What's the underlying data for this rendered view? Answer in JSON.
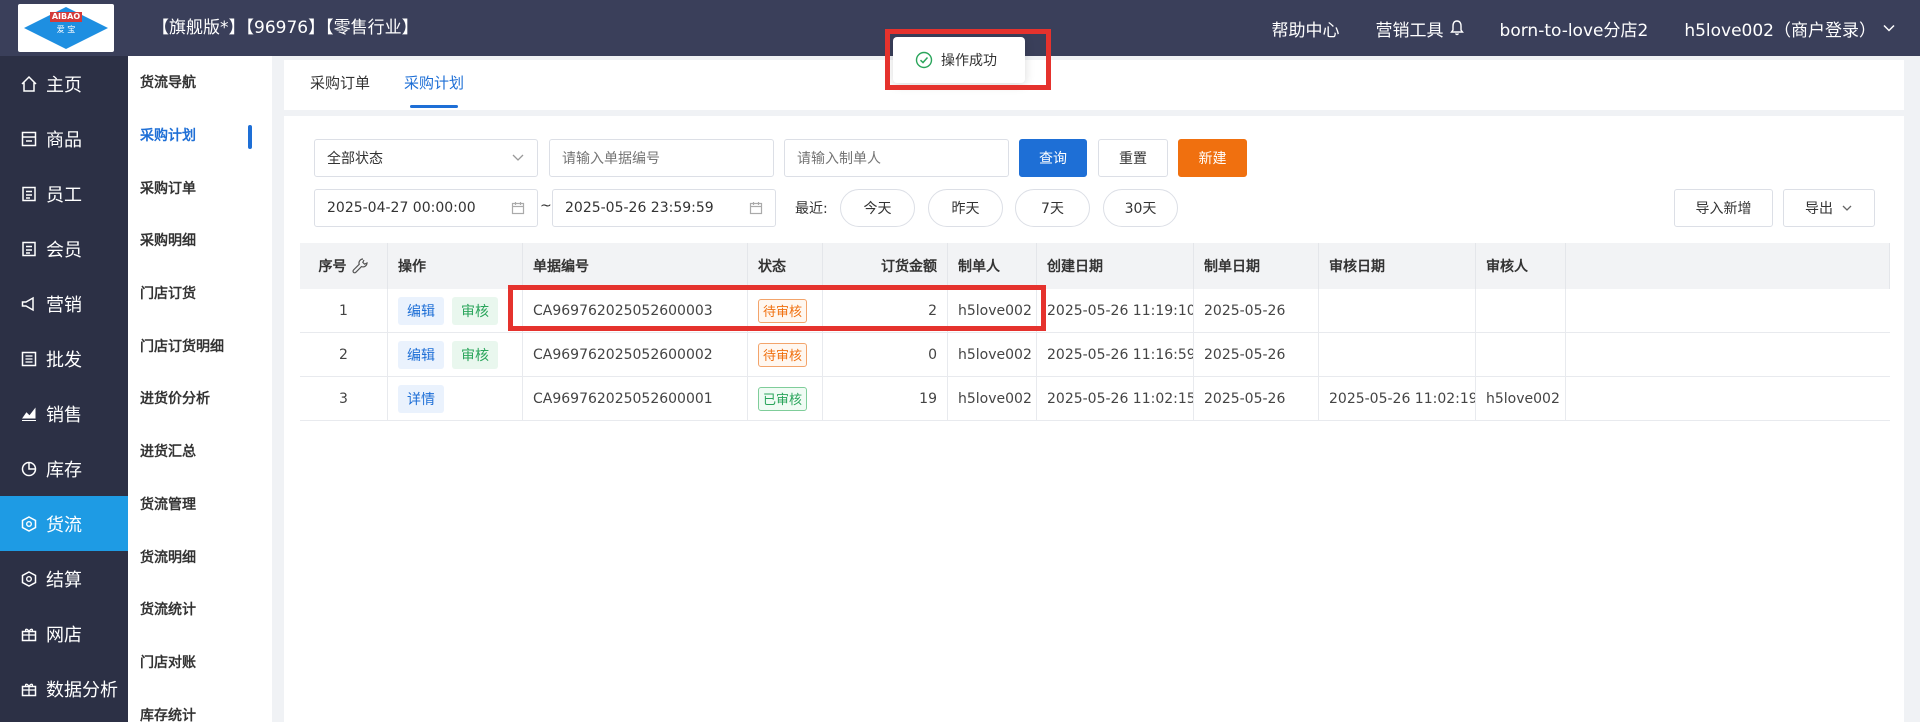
{
  "header": {
    "logo_top": "AIBAO",
    "logo_bottom": "爱 宝",
    "edition": "【旗舰版*】【96976】【零售行业】",
    "help": "帮助中心",
    "marketing": "营销工具",
    "store": "born-to-love分店2",
    "user": "h5love002（商户登录）"
  },
  "sidebar": {
    "items": [
      {
        "label": "主页",
        "icon": "home-icon"
      },
      {
        "label": "商品",
        "icon": "goods-icon"
      },
      {
        "label": "员工",
        "icon": "staff-icon"
      },
      {
        "label": "会员",
        "icon": "member-icon"
      },
      {
        "label": "营销",
        "icon": "megaphone-icon"
      },
      {
        "label": "批发",
        "icon": "wholesale-icon"
      },
      {
        "label": "销售",
        "icon": "sales-chart-icon"
      },
      {
        "label": "库存",
        "icon": "stock-pie-icon"
      },
      {
        "label": "货流",
        "icon": "logistics-icon"
      },
      {
        "label": "结算",
        "icon": "settle-icon"
      },
      {
        "label": "网店",
        "icon": "gift-icon"
      },
      {
        "label": "数据分析",
        "icon": "gift-icon"
      }
    ],
    "active_index": 8
  },
  "subnav": {
    "items": [
      "货流导航",
      "采购计划",
      "采购订单",
      "采购明细",
      "门店订货",
      "门店订货明细",
      "进货价分析",
      "进货汇总",
      "货流管理",
      "货流明细",
      "货流统计",
      "门店对账",
      "库存统计"
    ],
    "active_index": 1
  },
  "tabs": [
    "采购订单",
    "采购计划"
  ],
  "active_tab": 1,
  "filters": {
    "status_select": "全部状态",
    "doc_no_placeholder": "请输入单据编号",
    "maker_placeholder": "请输入制单人",
    "query": "查询",
    "reset": "重置",
    "create": "新建",
    "date_start": "2025-04-27 00:00:00",
    "date_sep": "~",
    "date_end": "2025-05-26 23:59:59",
    "recent_label": "最近:",
    "today": "今天",
    "yesterday": "昨天",
    "days7": "7天",
    "days30": "30天",
    "import": "导入新增",
    "export": "导出"
  },
  "table": {
    "headers": [
      "序号",
      "操作",
      "单据编号",
      "状态",
      "订货金额",
      "制单人",
      "创建日期",
      "制单日期",
      "审核日期",
      "审核人"
    ],
    "rows": [
      {
        "idx": "1",
        "ops": [
          "编辑",
          "审核"
        ],
        "no": "CA969762025052600003",
        "status": "待审核",
        "status_type": "pending",
        "amount": "2",
        "maker": "h5love002",
        "created": "2025-05-26 11:19:10",
        "made": "2025-05-26",
        "audited": "",
        "auditor": ""
      },
      {
        "idx": "2",
        "ops": [
          "编辑",
          "审核"
        ],
        "no": "CA969762025052600002",
        "status": "待审核",
        "status_type": "pending",
        "amount": "0",
        "maker": "h5love002",
        "created": "2025-05-26 11:16:59",
        "made": "2025-05-26",
        "audited": "",
        "auditor": ""
      },
      {
        "idx": "3",
        "ops": [
          "详情"
        ],
        "no": "CA969762025052600001",
        "status": "已审核",
        "status_type": "done",
        "amount": "19",
        "maker": "h5love002",
        "created": "2025-05-26 11:02:15",
        "made": "2025-05-26",
        "audited": "2025-05-26 11:02:19",
        "auditor": "h5love002"
      }
    ]
  },
  "toast": {
    "message": "操作成功"
  },
  "colors": {
    "accent": "#1e6fd6",
    "sidebar_active": "#1e9be4",
    "orange": "#f0700f",
    "highlight": "#e5322d"
  }
}
